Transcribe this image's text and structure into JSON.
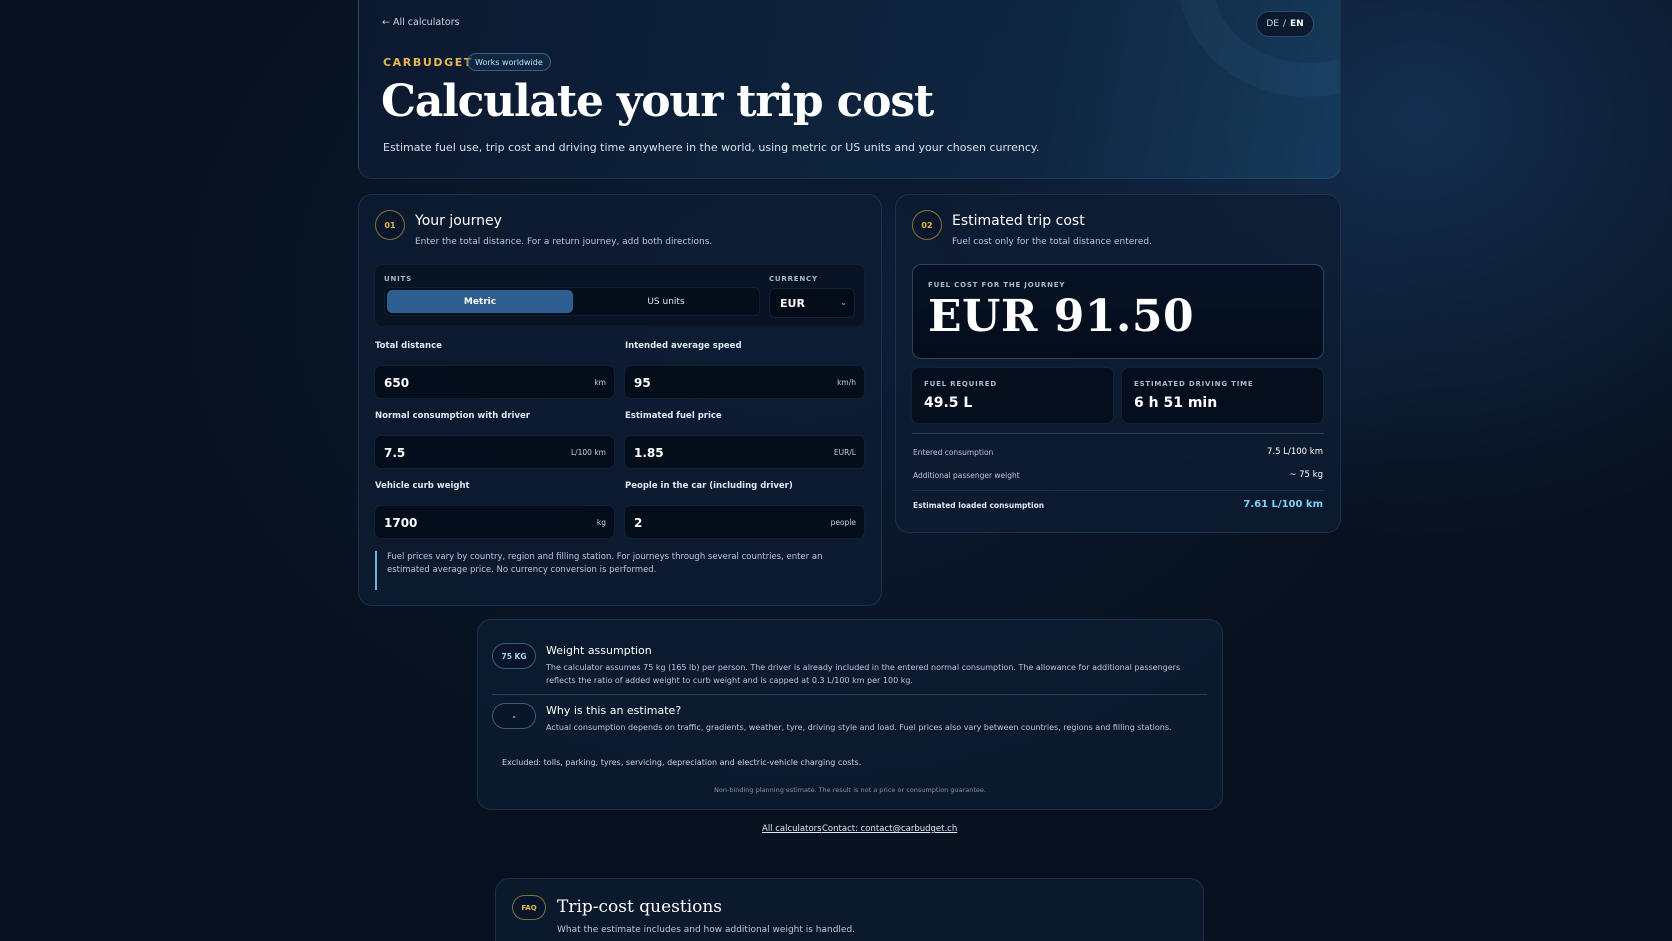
{
  "nav": {
    "back_link": "← All calculators",
    "lang_de": "DE",
    "lang_sep": "/",
    "lang_en": "EN"
  },
  "hero": {
    "brand": "CARBUDGET",
    "tag": "Works worldwide",
    "title": "Calculate your trip cost",
    "subtitle": "Estimate fuel use, trip cost and driving time anywhere in the world, using metric or US units and your chosen currency."
  },
  "journey": {
    "step": "01",
    "title": "Your journey",
    "subtitle": "Enter the total distance. For a return journey, add both directions.",
    "units_label": "UNITS",
    "units_options": [
      "Metric",
      "US units"
    ],
    "units_selected": "Metric",
    "currency_label": "CURRENCY",
    "currency_value": "EUR",
    "fields": {
      "distance": {
        "label": "Total distance",
        "value": "650",
        "unit": "km"
      },
      "speed": {
        "label": "Intended average speed",
        "value": "95",
        "unit": "km/h"
      },
      "consumption": {
        "label": "Normal consumption with driver",
        "value": "7.5",
        "unit": "L/100 km"
      },
      "fuel_price": {
        "label": "Estimated fuel price",
        "value": "1.85",
        "unit": "EUR/L"
      },
      "weight": {
        "label": "Vehicle curb weight",
        "value": "1700",
        "unit": "kg"
      },
      "people": {
        "label": "People in the car (including driver)",
        "value": "2",
        "unit": "people"
      }
    },
    "note": "Fuel prices vary by country, region and filling station. For journeys through several countries, enter an estimated average price. No currency conversion is performed."
  },
  "result": {
    "step": "02",
    "title": "Estimated trip cost",
    "subtitle": "Fuel cost only for the total distance entered.",
    "cost_label": "FUEL COST FOR THE JOURNEY",
    "cost_value": "EUR 91.50",
    "fuel_label": "FUEL REQUIRED",
    "fuel_value": "49.5 L",
    "time_label": "ESTIMATED DRIVING TIME",
    "time_value": "6 h 51 min",
    "rows": [
      {
        "label": "Entered consumption",
        "value": "7.5 L/100 km"
      },
      {
        "label": "Additional passenger weight",
        "value": "~ 75 kg"
      }
    ],
    "loaded_label": "Estimated loaded consumption",
    "loaded_value": "7.61 L/100 km",
    "accent_color": "#7fd0f5"
  },
  "info": {
    "weight_badge": "75 KG",
    "weight_title": "Weight assumption",
    "weight_body": "The calculator assumes 75 kg (165 lb) per person. The driver is already included in the entered normal consumption. The allowance for additional passengers reflects the ratio of added weight to curb weight and is capped at 0.3 L/100 km per 100 kg.",
    "estimate_badge": "-",
    "estimate_title": "Why is this an estimate?",
    "estimate_body": "Actual consumption depends on traffic, gradients, weather, tyre, driving style and load. Fuel prices also vary between countries, regions and filling stations.",
    "excluded": "Excluded: tolls, parking, tyres, servicing, depreciation and electric-vehicle charging costs.",
    "disclaimer": "Non-binding planning estimate. The result is not a price or consumption guarantee."
  },
  "footer": {
    "link_all": "All calculators",
    "link_contact": "Contact: contact@carbudget.ch"
  },
  "faq": {
    "badge": "FAQ",
    "title": "Trip-cost questions",
    "subtitle": "What the estimate includes and how additional weight is handled."
  }
}
